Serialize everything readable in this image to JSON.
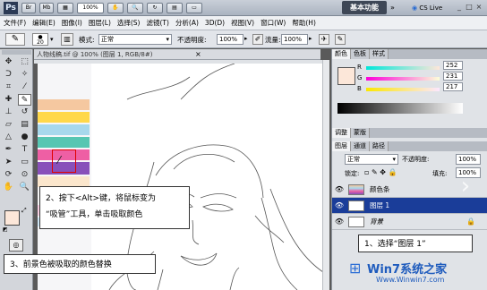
{
  "app": {
    "logo": "Ps",
    "tb_btn1": "Br",
    "tb_btn2": "Mb",
    "zoom": "100%",
    "essentials": "基本功能",
    "cslive": "CS Live",
    "win_btns": [
      "_",
      "□",
      "×"
    ]
  },
  "menu": [
    "文件(F)",
    "编辑(E)",
    "图像(I)",
    "图层(L)",
    "选择(S)",
    "滤镜(T)",
    "分析(A)",
    "3D(D)",
    "视图(V)",
    "窗口(W)",
    "帮助(H)"
  ],
  "options": {
    "brush_size": "20",
    "mode_label": "模式:",
    "mode_value": "正常",
    "opacity_label": "不透明度:",
    "opacity_value": "100%",
    "flow_label": "流量:",
    "flow_value": "100%"
  },
  "document": {
    "title": "人物线稿.tif @ 100% (图层 1, RGB/8#)",
    "close": "×"
  },
  "swatches": [
    "#f5c8a0",
    "#ffd84a",
    "#a7d8ec",
    "#56c6b2",
    "#ee5fa4",
    "#8850ba",
    "#fbe6cc",
    "#f7f7f7",
    "#fad1e4",
    "#cfe7f6"
  ],
  "color_panel": {
    "tabs": [
      "颜色",
      "色板",
      "样式"
    ],
    "r_label": "R",
    "r": "252",
    "g_label": "G",
    "g": "231",
    "b_label": "B",
    "b": "217",
    "fg": "#fce7d9",
    "colors": {
      "r_track": "#ff4040",
      "g_track": "#e040e0",
      "b_track": "#e0e040"
    }
  },
  "layers_panel": {
    "tabs": [
      "图层",
      "通道",
      "路径"
    ],
    "adj_tabs": [
      "调整",
      "蒙版"
    ],
    "blend": "正常",
    "opacity_label": "不透明度:",
    "opacity": "100%",
    "lock_label": "锁定:",
    "fill_label": "填充:",
    "fill": "100%",
    "layers": [
      {
        "name": "颜色条",
        "selected": false
      },
      {
        "name": "图层 1",
        "selected": true
      },
      {
        "name": "背景",
        "selected": false
      }
    ]
  },
  "annotations": {
    "step2_line1": "2、按下<Alt>键，将鼠标变为",
    "step2_line2": "“吸管”工具，单击吸取颜色",
    "step3": "3、前景色被吸取的颜色替换",
    "step1": "1、选择“图层 1”"
  },
  "watermark": {
    "brand": "Win7系统之家",
    "url": "Www.Winwin7.com"
  }
}
